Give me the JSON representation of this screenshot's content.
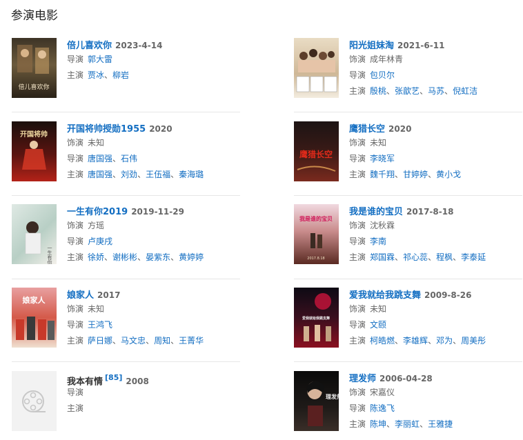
{
  "section_title": "参演电影",
  "films": {
    "f1": {
      "title": "倍儿喜欢你",
      "year": "2023-4-14",
      "director_label": "导演",
      "directors": [
        "郭大雷"
      ],
      "cast_label": "主演",
      "cast": [
        "贾冰",
        "柳岩"
      ]
    },
    "f2": {
      "title": "阳光姐妹淘",
      "year": "2021-6-11",
      "role_label": "饰演",
      "role": "成年林青",
      "director_label": "导演",
      "directors": [
        "包贝尔"
      ],
      "cast_label": "主演",
      "cast": [
        "殷桃",
        "张歆艺",
        "马苏",
        "倪虹洁"
      ]
    },
    "f3": {
      "title": "开国将帅授勋1955",
      "year": "2020",
      "role_label": "饰演",
      "role": "未知",
      "director_label": "导演",
      "directors": [
        "唐国强",
        "石伟"
      ],
      "cast_label": "主演",
      "cast": [
        "唐国强",
        "刘劲",
        "王伍福",
        "秦海璐"
      ]
    },
    "f4": {
      "title": "鹰猎长空",
      "year": "2020",
      "role_label": "饰演",
      "role": "未知",
      "director_label": "导演",
      "directors": [
        "李晓军"
      ],
      "cast_label": "主演",
      "cast": [
        "魏千翔",
        "甘婷婷",
        "黄小戈"
      ]
    },
    "f5": {
      "title": "一生有你2019",
      "year": "2019-11-29",
      "role_label": "饰演",
      "role": "方瑶",
      "director_label": "导演",
      "directors": [
        "卢庚戌"
      ],
      "cast_label": "主演",
      "cast": [
        "徐娇",
        "谢彬彬",
        "晏紫东",
        "黄婷婷"
      ]
    },
    "f6": {
      "title": "我是谁的宝贝",
      "year": "2017-8-18",
      "role_label": "饰演",
      "role": "沈秋霖",
      "director_label": "导演",
      "directors": [
        "李南"
      ],
      "cast_label": "主演",
      "cast": [
        "郑国霖",
        "祁心蕊",
        "程枫",
        "李泰延"
      ]
    },
    "f7": {
      "title": "娘家人",
      "year": "2017",
      "role_label": "饰演",
      "role": "未知",
      "director_label": "导演",
      "directors": [
        "王鸿飞"
      ],
      "cast_label": "主演",
      "cast": [
        "萨日娜",
        "马文忠",
        "周知",
        "王菁华"
      ]
    },
    "f8": {
      "title": "爱我就给我跳支舞",
      "year": "2009-8-26",
      "role_label": "饰演",
      "role": "未知",
      "director_label": "导演",
      "directors": [
        "文颐"
      ],
      "cast_label": "主演",
      "cast": [
        "柯皓燃",
        "李雄辉",
        "邓为",
        "周美彤"
      ]
    },
    "f9": {
      "title": "我本有情",
      "citation": "[85]",
      "year": "2008",
      "director_label": "导演",
      "cast_label": "主演"
    },
    "f10": {
      "title": "理发师",
      "year": "2006-04-28",
      "role_label": "饰演",
      "role": "宋嘉仪",
      "director_label": "导演",
      "directors": [
        "陈逸飞"
      ],
      "cast_label": "主演",
      "cast": [
        "陈坤",
        "李丽虹",
        "王雅捷"
      ]
    }
  },
  "poster_texts": {
    "f1": "倍儿喜欢你",
    "f3": "开国将帅",
    "f4": "鹰猎长空",
    "f6": "我是谁的宝贝",
    "f7": "娘家人",
    "f8": "爱我就给我跳支舞",
    "f10": "理发师"
  },
  "colors": {
    "link": "#136ec2",
    "meta": "#666666",
    "divider": "#e6e6e6"
  }
}
